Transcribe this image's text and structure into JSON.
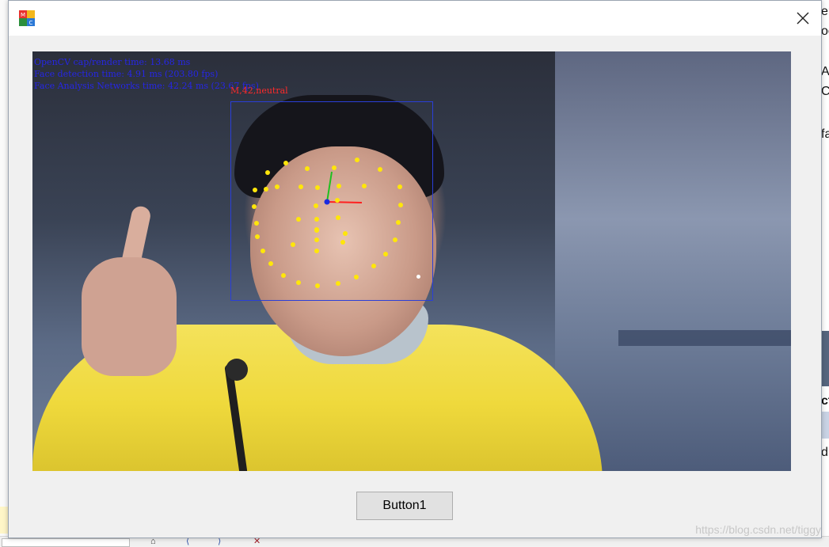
{
  "window": {
    "app_icon": "app-cube-icon",
    "close_icon": "close-icon"
  },
  "video": {
    "overlay_lines": [
      "OpenCV cap/render time: 13.68 ms",
      "Face detection time: 4.91 ms (203.80 fps)",
      "Face Analysis Networks time: 42.24 ms (23.67 fps)"
    ],
    "face_label": "M,42,neutral",
    "colors": {
      "overlay_text": "#2626e6",
      "face_label": "#ff2a2a",
      "box": "#2a3fd8",
      "landmark": "#ffe60a"
    }
  },
  "buttons": {
    "button1_label": "Button1"
  },
  "background": {
    "right_fragments": [
      "er",
      "oc",
      "A",
      "C",
      "fa",
      "ct",
      "di"
    ],
    "watermark": "https://blog.csdn.net/tiggy"
  }
}
